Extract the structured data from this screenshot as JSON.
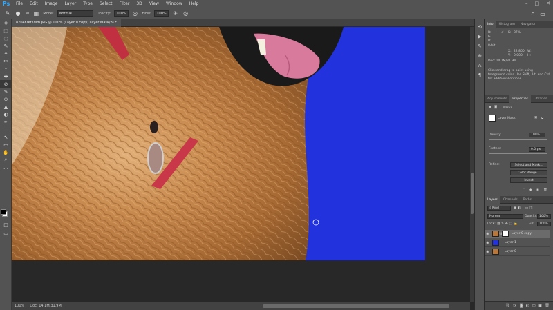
{
  "app": {
    "logo": "Ps"
  },
  "menu": [
    "File",
    "Edit",
    "Image",
    "Layer",
    "Type",
    "Select",
    "Filter",
    "3D",
    "View",
    "Window",
    "Help"
  ],
  "window_controls": [
    "–",
    "□",
    "✕"
  ],
  "options_bar": {
    "brush_size": "30",
    "mode_label": "Mode:",
    "mode_value": "Normal",
    "opacity_label": "Opacity:",
    "opacity_value": "100%",
    "flow_label": "Flow:",
    "flow_value": "100%"
  },
  "document": {
    "tab_title": "8704f7ef7dim.JPG @ 100% (Layer 0 copy, Layer Mask/8) *",
    "zoom": "100%",
    "doc_info": "Doc: 14.1M/31.9M",
    "bg_color": "#2233dd"
  },
  "info_panel": {
    "tabs": [
      "Info",
      "Histogram",
      "Navigator"
    ],
    "r_label": "R:",
    "g_label": "G:",
    "b_label": "B:",
    "k_label": "K:",
    "k_value": "87%",
    "bit_depth": "8-bit",
    "x_label": "X:",
    "x_value": "22.860",
    "y_label": "Y:",
    "y_value": "0.000",
    "w_label": "W:",
    "h_label": "H:",
    "doc_info": "Doc: 14.1M/31.9M",
    "hint": "Click and drag to paint using foreground color. Use Shift, Alt, and Ctrl for additional options."
  },
  "properties_panel": {
    "tabs": [
      "Adjustments",
      "Properties",
      "Libraries"
    ],
    "title": "Masks",
    "mask_type": "Layer Mask",
    "density_label": "Density:",
    "density_value": "100%",
    "feather_label": "Feather:",
    "feather_value": "0.0 px",
    "refine_label": "Refine:",
    "select_and_mask": "Select and Mask...",
    "color_range": "Color Range...",
    "invert": "Invert"
  },
  "layers_panel": {
    "tabs": [
      "Layers",
      "Channels",
      "Paths"
    ],
    "filter_kind": "Kind",
    "blend_mode": "Normal",
    "opacity_label": "Opacity:",
    "opacity_value": "100%",
    "lock_label": "Lock:",
    "fill_label": "Fill:",
    "fill_value": "100%",
    "layers": [
      {
        "name": "Layer 0 copy",
        "selected": true,
        "thumb": "#b9773a"
      },
      {
        "name": "Layer 1",
        "selected": false,
        "thumb": "#2233dd"
      },
      {
        "name": "Layer 0",
        "selected": false,
        "thumb": "#b9773a"
      }
    ]
  },
  "tools": [
    "✥",
    "⬚",
    "◌",
    "✎",
    "⌗",
    "✂",
    "⌖",
    "✚",
    "⊘",
    "✎",
    "⊙",
    "▲",
    "◐",
    "✒",
    "T",
    "↖",
    "▭",
    "✋",
    "⌕",
    "…"
  ]
}
